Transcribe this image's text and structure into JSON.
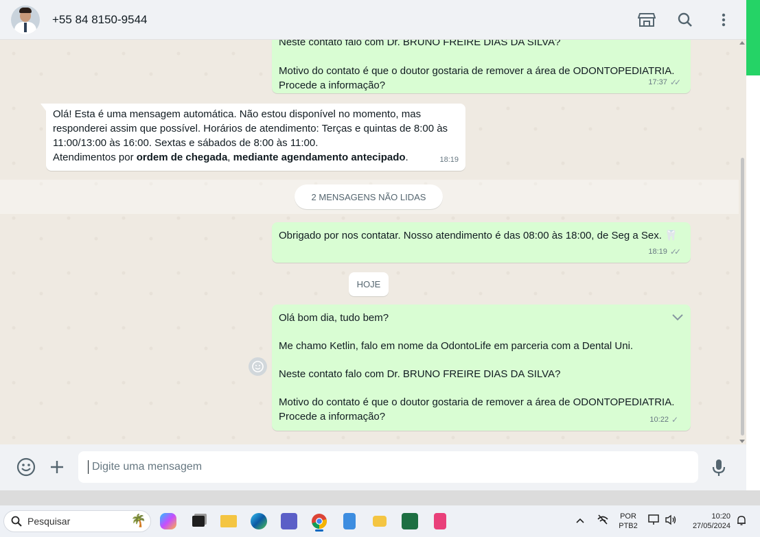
{
  "header": {
    "contact": "+55 84 8150-9544",
    "icons": [
      "store-icon",
      "search-icon",
      "more-icon"
    ]
  },
  "messages": {
    "m1": {
      "line_top": "Neste contato falo com Dr. BRUNO FREIRE DIAS DA SILVA?",
      "line_a": "Motivo do contato é que o doutor gostaria de remover a área de ODONTOPEDIATRIA.",
      "line_b": "Procede a informação?",
      "time": "17:37"
    },
    "m2": {
      "line1": "Olá! Esta é uma mensagem automática. Não estou disponível no momento, mas",
      "line2": "responderei assim que possível. Horários de atendimento: Terças e quintas de 8:00 às",
      "line3": "11:00/13:00 às 16:00. Sextas e sábados de 8:00 às 11:00.",
      "line4_pre": "Atendimentos por ",
      "line4_b1": "ordem de chegada",
      "line4_mid": ", ",
      "line4_b2": "mediante agendamento antecipado",
      "line4_end": ".",
      "time": "18:19"
    },
    "unread": "2 MENSAGENS NÃO LIDAS",
    "m3": {
      "text": "Obrigado por nos contatar. Nosso atendimento é das 08:00 às 18:00, de Seg a Sex.",
      "emoji": "🦷",
      "time": "18:19"
    },
    "today": "HOJE",
    "m4": {
      "greeting": "Olá bom dia, tudo bem?",
      "intro": "Me chamo Ketlin, falo em nome da OdontoLife em parceria com a Dental Uni.",
      "question": "Neste contato falo com Dr. BRUNO FREIRE DIAS DA SILVA?",
      "reason_a": "Motivo do contato é que o doutor gostaria de remover a área de ODONTOPEDIATRIA.",
      "reason_b": "Procede a informação?",
      "time": "10:22"
    }
  },
  "compose": {
    "placeholder": "Digite uma mensagem"
  },
  "taskbar": {
    "search_label": "Pesquisar",
    "lang_top": "POR",
    "lang_bottom": "PTB2",
    "time": "10:20",
    "date": "27/05/2024"
  },
  "colors": {
    "outgoing": "#d9fdd3",
    "incoming": "#ffffff",
    "chat_bg": "#efeae2",
    "accent": "#25d366"
  }
}
